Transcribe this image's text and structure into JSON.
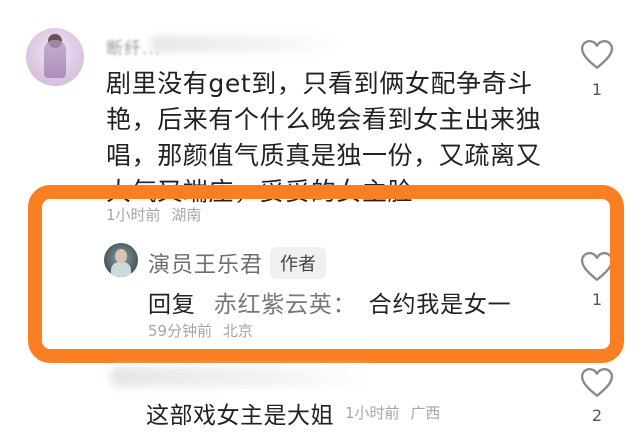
{
  "comment1": {
    "username": "断纤...",
    "lines": [
      "剧里没有get到，只看到俩女配争奇斗",
      "艳，后来有个什么晚会看到女主出来独",
      "唱，那颜值气质真是独一份，又疏离又",
      "大气又端庄，妥妥的女主脸"
    ],
    "time": "1小时前",
    "location": "湖南",
    "likes": "1"
  },
  "reply": {
    "author": "演员王乐君",
    "author_tag": "作者",
    "prefix": "回复",
    "target": "赤红紫云英：",
    "text": "合约我是女一",
    "time": "59分钟前",
    "location": "北京",
    "likes": "1"
  },
  "comment2": {
    "text": "这部戏女主是大姐",
    "time": "1小时前",
    "location": "广西",
    "likes": "2"
  },
  "colors": {
    "highlight": "#fa7f23",
    "meta": "#a6a6a6",
    "heart_outline": "#8a8a8a"
  }
}
